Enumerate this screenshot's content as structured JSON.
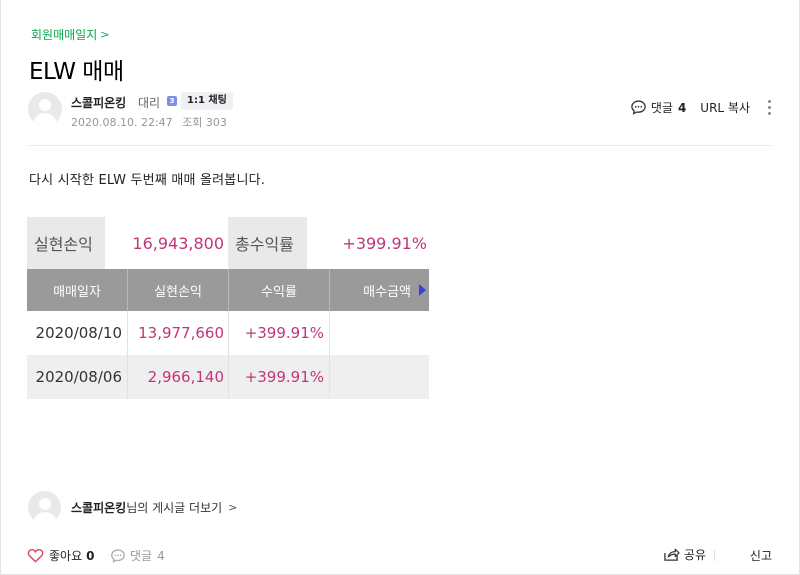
{
  "post": {
    "category": "회원매매일지",
    "title": "ELW 매매",
    "author": {
      "name": "스콜피온킹",
      "rank": "대리",
      "rank_badge": "3",
      "chat_label": "1:1 채팅"
    },
    "date": "2020.08.10. 22:47",
    "views_label": "조회 303",
    "comments_label": "댓글",
    "comments_count": "4",
    "url_copy_label": "URL 복사",
    "body_text": "다시 시작한 ELW 두번째 매매 올려봅니다."
  },
  "summary": {
    "realized_label": "실현손익",
    "realized_value": "16,943,800",
    "total_return_label": "총수익률",
    "total_return_value": "+399.91%"
  },
  "trade_table": {
    "headers": [
      "매매일자",
      "실현손익",
      "수익률",
      "매수금액"
    ],
    "rows": [
      {
        "date": "2020/08/10",
        "pl": "13,977,660",
        "rate": "+399.91%",
        "buy": ""
      },
      {
        "date": "2020/08/06",
        "pl": "2,966,140",
        "rate": "+399.91%",
        "buy": ""
      }
    ]
  },
  "more_posts": {
    "author": "스콜피온킹",
    "suffix": "님의 게시글 더보기"
  },
  "footer": {
    "like_label": "좋아요",
    "like_count": "0",
    "comment_label": "댓글",
    "comment_count": "4",
    "share_label": "공유",
    "report_label": "신고"
  },
  "colors": {
    "category_green": "#03a94f",
    "profit_pink": "#c2357a",
    "table_header": "#9a9a9a",
    "scroll_arrow": "#3a43d8",
    "like_heart": "#e0435a"
  },
  "icons": [
    "chevron-right-icon",
    "rank-icon",
    "speech-bubble-icon",
    "more-vertical-icon",
    "scroll-right-arrow-icon",
    "heart-icon",
    "share-icon",
    "default-avatar-icon"
  ]
}
